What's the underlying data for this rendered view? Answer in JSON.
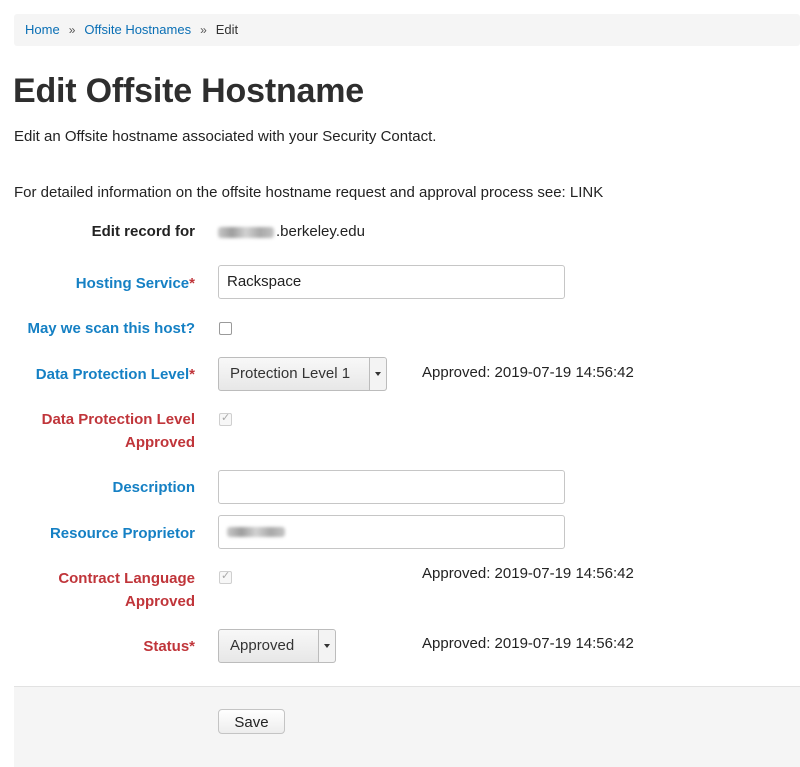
{
  "breadcrumb": {
    "home": "Home",
    "separator": "»",
    "section": "Offsite Hostnames",
    "current": "Edit"
  },
  "page": {
    "title": "Edit Offsite Hostname",
    "intro": "Edit an Offsite hostname associated with your Security Contact.",
    "info": "For detailed information on the offsite hostname request and approval process see: LINK"
  },
  "form": {
    "record": {
      "label": "Edit record for",
      "value_suffix": ".berkeley.edu"
    },
    "hosting_service": {
      "label": "Hosting Service",
      "required_mark": "*",
      "value": "Rackspace"
    },
    "scan_host": {
      "label": "May we scan this host?",
      "checked": false
    },
    "protection_level": {
      "label": "Data Protection Level",
      "required_mark": "*",
      "value": "Protection Level 1",
      "approved": "Approved: 2019-07-19 14:56:42"
    },
    "protection_level_approved": {
      "label_line1": "Data Protection Level",
      "label_line2": "Approved",
      "checked": true
    },
    "description": {
      "label": "Description",
      "value": ""
    },
    "resource_proprietor": {
      "label": "Resource Proprietor"
    },
    "contract_language": {
      "label_line1": "Contract Language",
      "label_line2": "Approved",
      "checked": true,
      "approved": "Approved: 2019-07-19 14:56:42"
    },
    "status": {
      "label": "Status",
      "required_mark": "*",
      "value": "Approved",
      "approved": "Approved: 2019-07-19 14:56:42"
    }
  },
  "actions": {
    "save_label": "Save"
  },
  "colors": {
    "link": "#0a6fb5",
    "label_blue": "#1580c4",
    "label_red": "#c0353a",
    "footer_bg": "#f5f5f5"
  },
  "icons": {
    "checkmark": "check-icon",
    "dropdown": "chevron-down-icon"
  }
}
